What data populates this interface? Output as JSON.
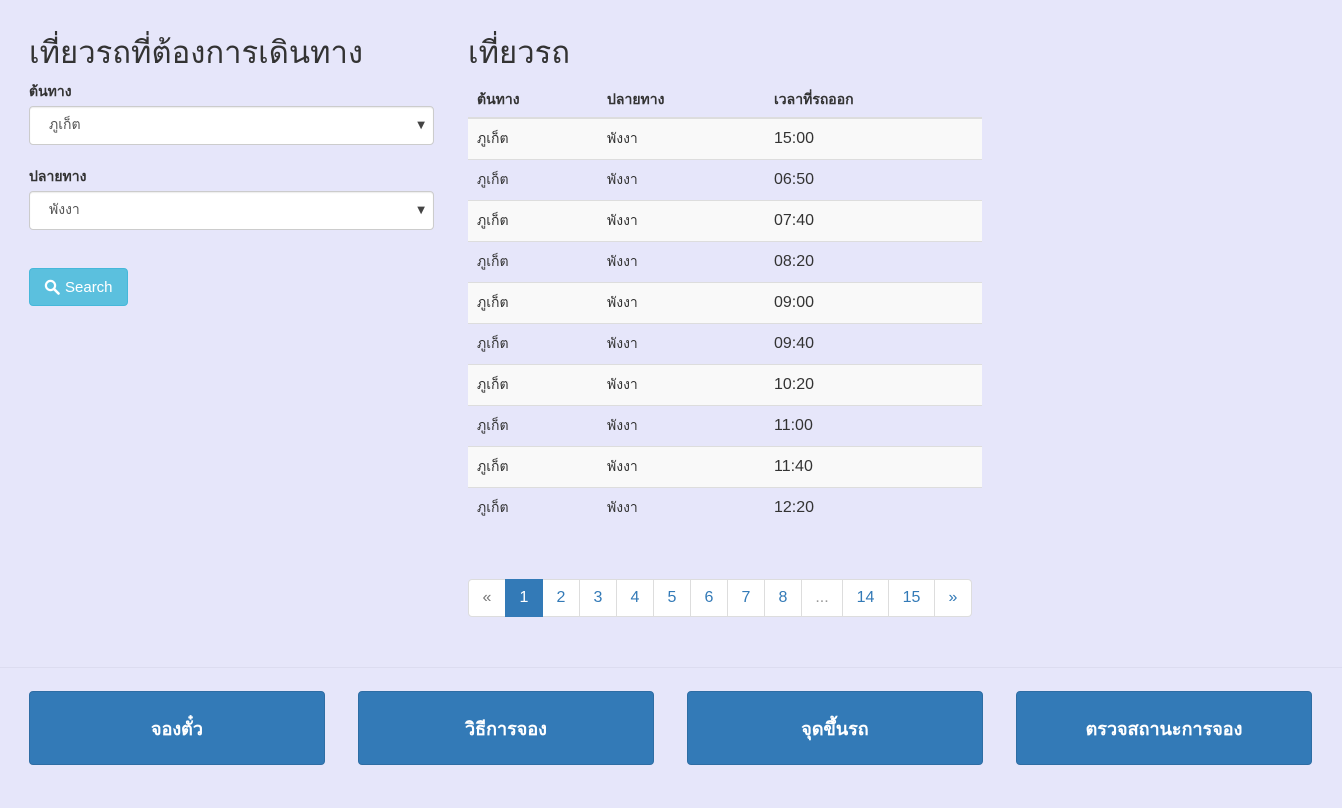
{
  "search": {
    "heading": "เที่ยวรถที่ต้องการเดินทาง",
    "origin_label": "ต้นทาง",
    "origin_value": "ภูเก็ต",
    "destination_label": "ปลายทาง",
    "destination_value": "พังงา",
    "search_button": "Search"
  },
  "trips": {
    "title": "เที่ยวรถ",
    "columns": [
      "ต้นทาง",
      "ปลายทาง",
      "เวลาที่รถออก"
    ],
    "rows": [
      [
        "ภูเก็ต",
        "พังงา",
        "15:00"
      ],
      [
        "ภูเก็ต",
        "พังงา",
        "06:50"
      ],
      [
        "ภูเก็ต",
        "พังงา",
        "07:40"
      ],
      [
        "ภูเก็ต",
        "พังงา",
        "08:20"
      ],
      [
        "ภูเก็ต",
        "พังงา",
        "09:00"
      ],
      [
        "ภูเก็ต",
        "พังงา",
        "09:40"
      ],
      [
        "ภูเก็ต",
        "พังงา",
        "10:20"
      ],
      [
        "ภูเก็ต",
        "พังงา",
        "11:00"
      ],
      [
        "ภูเก็ต",
        "พังงา",
        "11:40"
      ],
      [
        "ภูเก็ต",
        "พังงา",
        "12:20"
      ]
    ]
  },
  "pagination": {
    "prev": "«",
    "pages": [
      "1",
      "2",
      "3",
      "4",
      "5",
      "6",
      "7",
      "8",
      "...",
      "14",
      "15"
    ],
    "next": "»",
    "active_page": "1"
  },
  "footer": {
    "buttons": [
      "จองตั๋ว",
      "วิธีการจอง",
      "จุดขึ้นรถ",
      "ตรวจสถานะการจอง"
    ]
  },
  "colors": {
    "background": "#e6e6fa",
    "primary": "#337ab7",
    "info": "#5bc0de"
  }
}
